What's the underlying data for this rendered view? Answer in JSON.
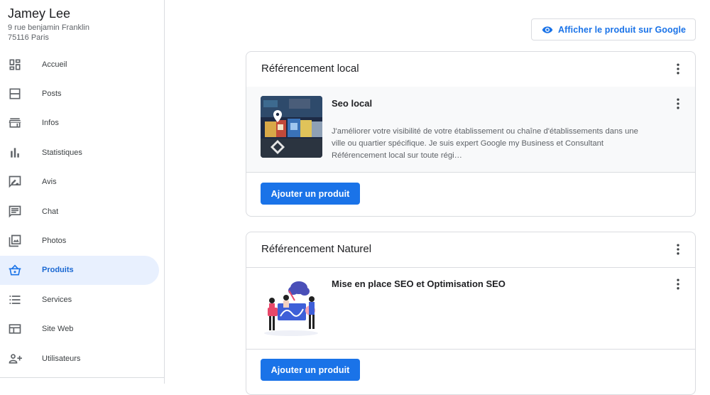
{
  "business": {
    "name": "Jamey Lee",
    "address_line1": "9 rue benjamin Franklin",
    "address_line2": "75116 Paris"
  },
  "sidebar": {
    "items": [
      {
        "label": "Accueil",
        "icon": "dashboard-icon"
      },
      {
        "label": "Posts",
        "icon": "posts-icon"
      },
      {
        "label": "Infos",
        "icon": "storefront-icon"
      },
      {
        "label": "Statistiques",
        "icon": "bar-chart-icon"
      },
      {
        "label": "Avis",
        "icon": "rate-review-icon"
      },
      {
        "label": "Chat",
        "icon": "chat-icon"
      },
      {
        "label": "Photos",
        "icon": "photo-icon"
      },
      {
        "label": "Produits",
        "icon": "shopping-basket-icon",
        "active": true
      },
      {
        "label": "Services",
        "icon": "list-icon"
      },
      {
        "label": "Site Web",
        "icon": "web-icon"
      },
      {
        "label": "Utilisateurs",
        "icon": "person-add-icon"
      }
    ]
  },
  "header": {
    "view_button_label": "Afficher le produit sur Google"
  },
  "sections": [
    {
      "title": "Référencement local",
      "products": [
        {
          "name": "Seo local",
          "description": "J'améliorer votre visibilité de votre établissement ou chaîne d'établissements dans une ville ou quartier spécifique. Je suis expert Google my Business et Consultant Référencement local sur toute régi…"
        }
      ],
      "add_button_label": "Ajouter un produit"
    },
    {
      "title": "Référencement Naturel",
      "products": [
        {
          "name": "Mise en place SEO et Optimisation SEO",
          "description": ""
        }
      ],
      "add_button_label": "Ajouter un produit"
    }
  ],
  "colors": {
    "accent": "#1a73e8",
    "active_bg": "#e8f0fe",
    "border": "#dadce0"
  }
}
